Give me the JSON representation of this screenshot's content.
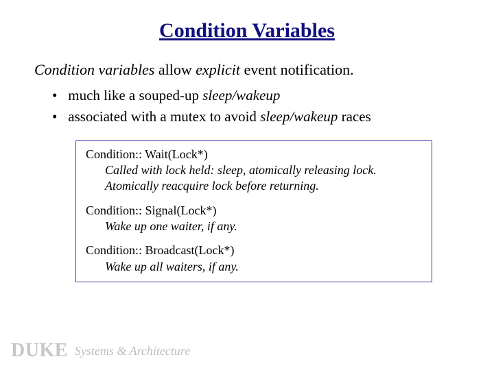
{
  "title": "Condition Variables",
  "intro": {
    "lead": "Condition variables",
    "middle": " allow ",
    "em": "explicit",
    "tail": " event notification."
  },
  "bullets": [
    {
      "pre": "much like a souped-up ",
      "em": "sleep/wakeup",
      "post": ""
    },
    {
      "pre": "associated with a mutex to avoid ",
      "em": "sleep/wakeup",
      "post": " races"
    }
  ],
  "methods": [
    {
      "sig": "Condition:: Wait(Lock*)",
      "desc": [
        "Called with lock held: sleep, atomically releasing lock.",
        "Atomically reacquire lock before returning."
      ]
    },
    {
      "sig": "Condition:: Signal(Lock*)",
      "desc": [
        "Wake up one waiter, if any."
      ]
    },
    {
      "sig": "Condition:: Broadcast(Lock*)",
      "desc": [
        "Wake up all waiters, if any."
      ]
    }
  ],
  "footer": {
    "duke": "DUKE",
    "sa": "Systems & Architecture"
  }
}
